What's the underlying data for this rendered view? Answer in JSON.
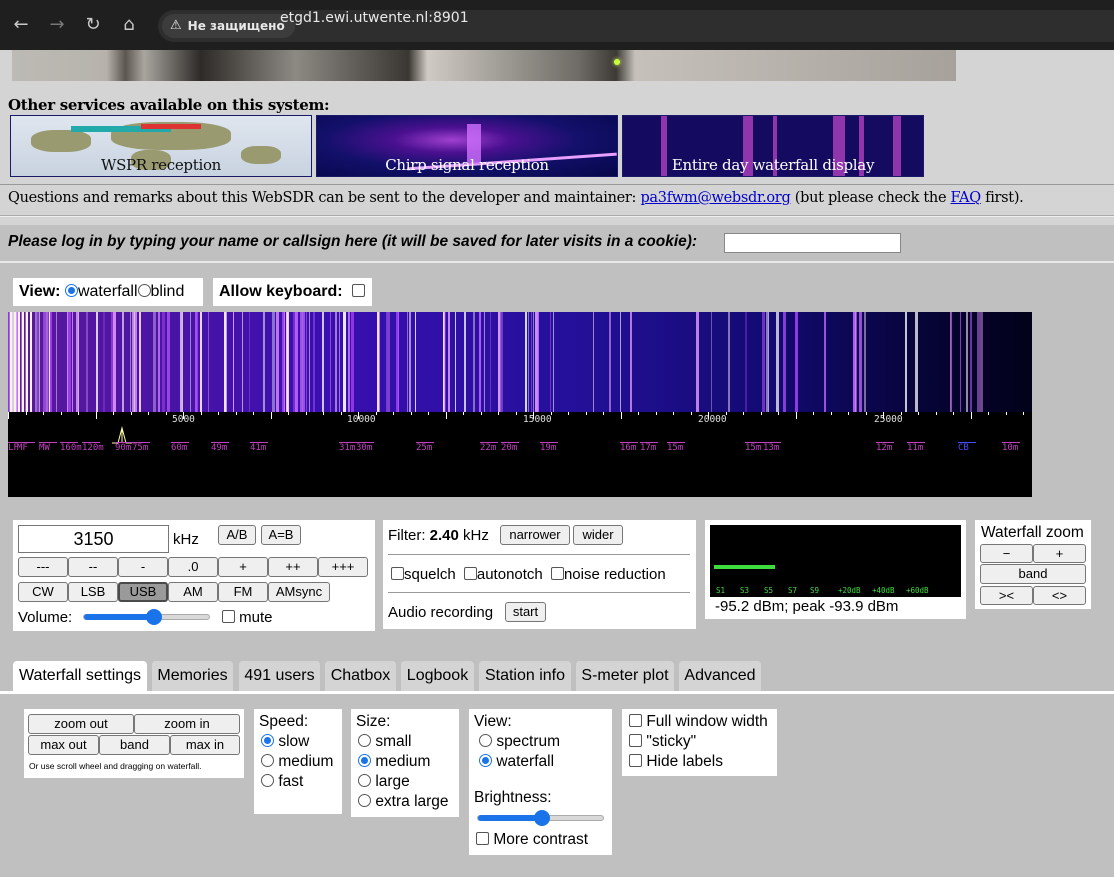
{
  "browser": {
    "security_label": "Не защищено",
    "url": "etgd1.ewi.utwente.nl:8901"
  },
  "services": {
    "title": "Other services available on this system:",
    "items": [
      {
        "label": "WSPR reception"
      },
      {
        "label": "Chirp signal reception"
      },
      {
        "label": "Entire day waterfall display"
      }
    ]
  },
  "contact": {
    "text_before": "Questions and remarks about this WebSDR can be sent to the developer and maintainer: ",
    "email": "pa3fwm@websdr.org",
    "text_middle": " (but please check the ",
    "faq": "FAQ",
    "text_after": " first)."
  },
  "login": {
    "prompt": "Please log in by typing your name or callsign here (it will be saved for later visits in a cookie):",
    "value": ""
  },
  "view": {
    "label": "View:",
    "options": [
      "waterfall",
      "blind"
    ],
    "selected": "waterfall"
  },
  "keyboard": {
    "label": "Allow keyboard:",
    "checked": false
  },
  "scale": {
    "ticks": [
      "5000",
      "10000",
      "15000",
      "20000",
      "25000"
    ],
    "bands": [
      "LF",
      "MF",
      "MW",
      "160m",
      "120m",
      "90m",
      "75m",
      "60m",
      "49m",
      "41m",
      "31m",
      "30m",
      "25m",
      "22m",
      "20m",
      "19m",
      "16m",
      "17m",
      "15m",
      "15m",
      "13m",
      "12m",
      "11m",
      "CB",
      "10m"
    ]
  },
  "frequency": {
    "value": "3150",
    "unit": "kHz",
    "ab_label": "A/B",
    "aeqb_label": "A=B",
    "step_buttons": [
      "---",
      "--",
      "-",
      ".0",
      "+",
      "++",
      "+++"
    ],
    "modes": [
      "CW",
      "LSB",
      "USB",
      "AM",
      "FM",
      "AMsync"
    ],
    "selected_mode": "USB",
    "volume_label": "Volume:",
    "volume_level": 0.55,
    "mute_label": "mute"
  },
  "filter": {
    "label": "Filter:",
    "value": "2.40",
    "unit": "kHz",
    "narrower": "narrower",
    "wider": "wider",
    "options": [
      "squelch",
      "autonotch",
      "noise reduction"
    ],
    "audio_label": "Audio recording",
    "start_label": "start"
  },
  "smeter": {
    "scale_labels": [
      "S1",
      "S3",
      "S5",
      "S7",
      "S9",
      "+20dB",
      "+40dB",
      "+60dB"
    ],
    "level": 0.25,
    "readout": "-95.2 dBm; peak  -93.9 dBm",
    "bar_color": "#3fdc3f"
  },
  "wfzoom": {
    "title": "Waterfall zoom",
    "minus": "−",
    "plus": "+",
    "band": "band",
    "left": "><",
    "right": "<>"
  },
  "tabs": [
    "Waterfall settings",
    "Memories",
    "491 users",
    "Chatbox",
    "Logbook",
    "Station info",
    "S-meter plot",
    "Advanced"
  ],
  "active_tab": "Waterfall settings",
  "wf_settings": {
    "zoom_out": "zoom out",
    "zoom_in": "zoom in",
    "max_out": "max out",
    "band": "band",
    "max_in": "max in",
    "hint": "Or use scroll wheel and dragging on waterfall.",
    "speed_label": "Speed:",
    "speed_options": [
      "slow",
      "medium",
      "fast"
    ],
    "speed_selected": "slow",
    "size_label": "Size:",
    "size_options": [
      "small",
      "medium",
      "large",
      "extra large"
    ],
    "size_selected": "medium",
    "view_label": "View:",
    "view_options": [
      "spectrum",
      "waterfall"
    ],
    "view_selected": "waterfall",
    "brightness_label": "Brightness:",
    "brightness_level": 0.5,
    "more_contrast": "More contrast",
    "checkboxes": [
      "Full window width",
      "\"sticky\"",
      "Hide labels"
    ]
  }
}
